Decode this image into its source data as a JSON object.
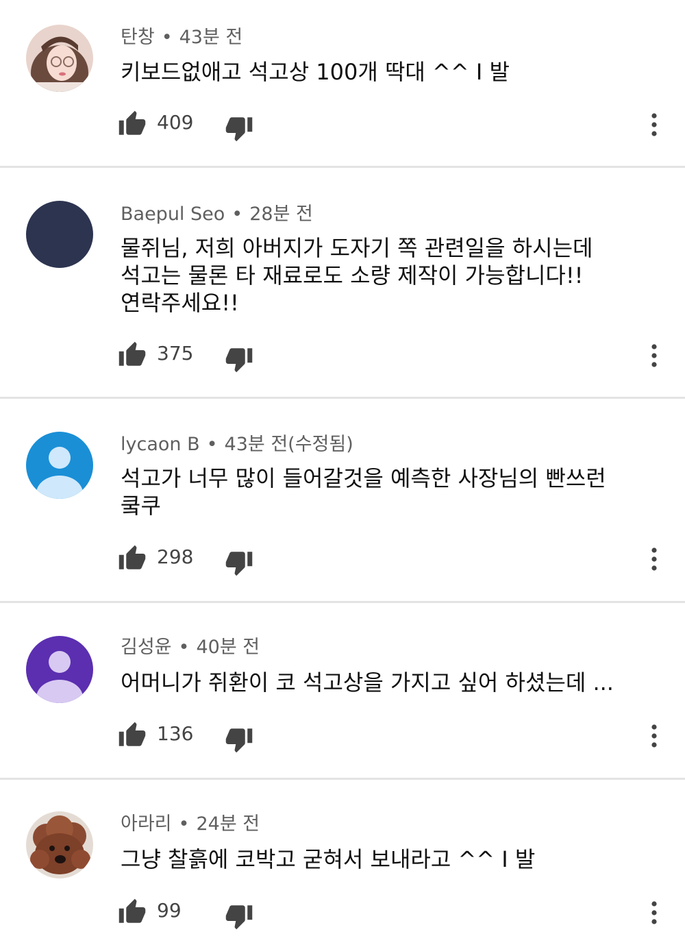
{
  "icons": {
    "like": "thumbs-up-icon",
    "dislike": "thumbs-down-icon",
    "more": "more-vertical-icon"
  },
  "colors": {
    "text": "#111111",
    "meta": "#5f5f5f",
    "icon": "#444444",
    "divider": "#e3e3e3"
  },
  "comments": [
    {
      "author": "탄창",
      "time": "43분 전",
      "text": "키보드없애고 석고상 100개 딱대 ^^ I 발",
      "likes": "409"
    },
    {
      "author": "Baepul Seo",
      "time": "28분 전",
      "text": "물쥐님, 저희 아버지가 도자기 쪽 관련일을 하시는데\n석고는 물론 타 재료로도 소량 제작이 가능합니다!!\n연락주세요!!",
      "likes": "375"
    },
    {
      "author": "lycaon B",
      "time": "43분 전(수정됨)",
      "text": "석고가 너무 많이 들어갈것을 예측한 사장님의 빤쓰런\n쿸쿠",
      "likes": "298"
    },
    {
      "author": "김성윤",
      "time": "40분 전",
      "text": "어머니가 쥐환이 코 석고상을 가지고 싶어 하셨는데 ...",
      "likes": "136"
    },
    {
      "author": "아라리",
      "time": "24분 전",
      "text": "그냥 찰흙에 코박고 굳혀서 보내라고 ^^ I 발",
      "likes": "99"
    }
  ]
}
